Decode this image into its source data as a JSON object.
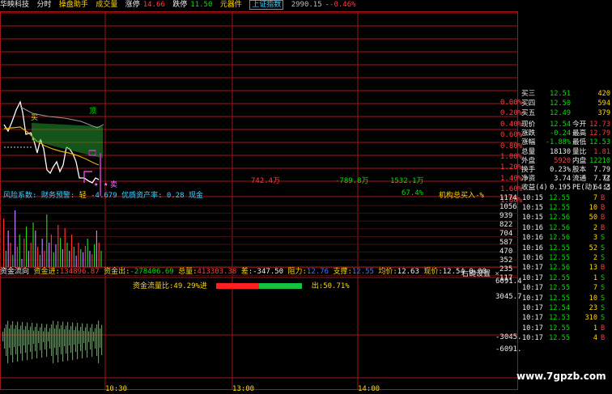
{
  "header": {
    "stock_name": "华映科技",
    "mode_tabs": [
      "分时",
      "操盘助手"
    ],
    "vol_label": "成交量",
    "limit_up_label": "涨停",
    "limit_up_value": "14.66",
    "limit_down_label": "跌停",
    "limit_down_value": "11.50",
    "sector": "元器件",
    "index_label": "上证指数",
    "index_value": "2990.15",
    "index_change": "-0.46%"
  },
  "price_axis_right": [
    "0.00%",
    "0.20%",
    "0.40%",
    "0.60%",
    "0.80%",
    "1.00%",
    "1.20%",
    "1.40%",
    "1.60%",
    "1.80%"
  ],
  "chart_labels": {
    "buy_tag": "买",
    "sell_tag": "卖",
    "top_tag": "顶",
    "flow_a": "742.4万",
    "flow_b": "-789.8万",
    "flow_c": "1532.1万",
    "pct_67": "67.4%",
    "inst_buy": "机构总买入-%"
  },
  "risk_line": {
    "prefix": "风险系数:",
    "warn": "财务预警:",
    "level": "轻",
    "num": "-4.679",
    "quality": "优质资产率:",
    "quality_val": "0.28",
    "cash": "现金"
  },
  "volume_axis": [
    "1174",
    "1056",
    "939",
    "822",
    "704",
    "587",
    "470",
    "352",
    "235",
    "117"
  ],
  "flow": {
    "title": "资金流向",
    "in_label": "资金进:",
    "in_val": "134896.87",
    "out_label": "资金出:",
    "out_val": "-278406.69",
    "total_label": "总量:",
    "total_val": "413303.38",
    "diff_label": "差:",
    "diff_val": "-347.50",
    "resist_label": "阻力:",
    "resist_val": "12.76",
    "support_label": "支撑:",
    "support_val": "12.55",
    "avg_label": "均价:",
    "avg_val": "12.63",
    "now_label": "现价:",
    "now_val": "12.54",
    "zero": "0.00",
    "settings": "右键设置",
    "close": "×",
    "ratio_in": "资金流量比:49.29%进",
    "ratio_out": "出:50.71%",
    "ratio_in_frac": 0.4929
  },
  "flow_axis": [
    "6091.4",
    "3045.7",
    "-3045.",
    "-6091."
  ],
  "time_axis": [
    "10:30",
    "13:00",
    "14:00"
  ],
  "orderbook": [
    {
      "label": "买三",
      "price": "12.51",
      "vol": "420"
    },
    {
      "label": "买四",
      "price": "12.50",
      "vol": "594"
    },
    {
      "label": "买五",
      "price": "12.49",
      "vol": "379"
    }
  ],
  "quote": [
    {
      "l1": "现价",
      "v1": "12.54",
      "l2": "今开",
      "v2": "12.73"
    },
    {
      "l1": "涨跌",
      "v1": "-0.24",
      "l2": "最高",
      "v2": "12.79"
    },
    {
      "l1": "涨幅",
      "v1": "-1.88%",
      "l2": "最低",
      "v2": "12.53"
    },
    {
      "l1": "总量",
      "v1": "18130",
      "l2": "量比",
      "v2": "1.81"
    },
    {
      "l1": "外盘",
      "v1": "5920",
      "l2": "内盘",
      "v2": "12210"
    },
    {
      "l1": "换手",
      "v1": "0.23%",
      "l2": "股本",
      "v2": "7.79亿"
    },
    {
      "l1": "净资",
      "v1": "3.74",
      "l2": "流通",
      "v2": "7.77亿"
    },
    {
      "l1": "收益(4)",
      "v1": "0.195",
      "l2": "PE(动)",
      "v2": "64.3"
    }
  ],
  "ticks": [
    {
      "t": "10:15",
      "p": "12.55",
      "v": "7",
      "d": "B"
    },
    {
      "t": "10:15",
      "p": "12.55",
      "v": "10",
      "d": "B"
    },
    {
      "t": "10:15",
      "p": "12.56",
      "v": "50",
      "d": "B"
    },
    {
      "t": "10:16",
      "p": "12.56",
      "v": "2",
      "d": "B"
    },
    {
      "t": "10:16",
      "p": "12.56",
      "v": "3",
      "d": "S"
    },
    {
      "t": "10:16",
      "p": "12.55",
      "v": "52",
      "d": "S"
    },
    {
      "t": "10:16",
      "p": "12.55",
      "v": "2",
      "d": "S"
    },
    {
      "t": "10:17",
      "p": "12.56",
      "v": "13",
      "d": "B"
    },
    {
      "t": "10:17",
      "p": "12.55",
      "v": "1",
      "d": "S"
    },
    {
      "t": "10:17",
      "p": "12.55",
      "v": "7",
      "d": "S"
    },
    {
      "t": "10:17",
      "p": "12.55",
      "v": "10",
      "d": "S"
    },
    {
      "t": "10:17",
      "p": "12.54",
      "v": "23",
      "d": "S"
    },
    {
      "t": "10:17",
      "p": "12.53",
      "v": "310",
      "d": "S"
    },
    {
      "t": "10:17",
      "p": "12.55",
      "v": "1",
      "d": "B"
    },
    {
      "t": "10:17",
      "p": "12.55",
      "v": "4",
      "d": "B"
    }
  ],
  "watermark": "www.7gpzb.com"
}
